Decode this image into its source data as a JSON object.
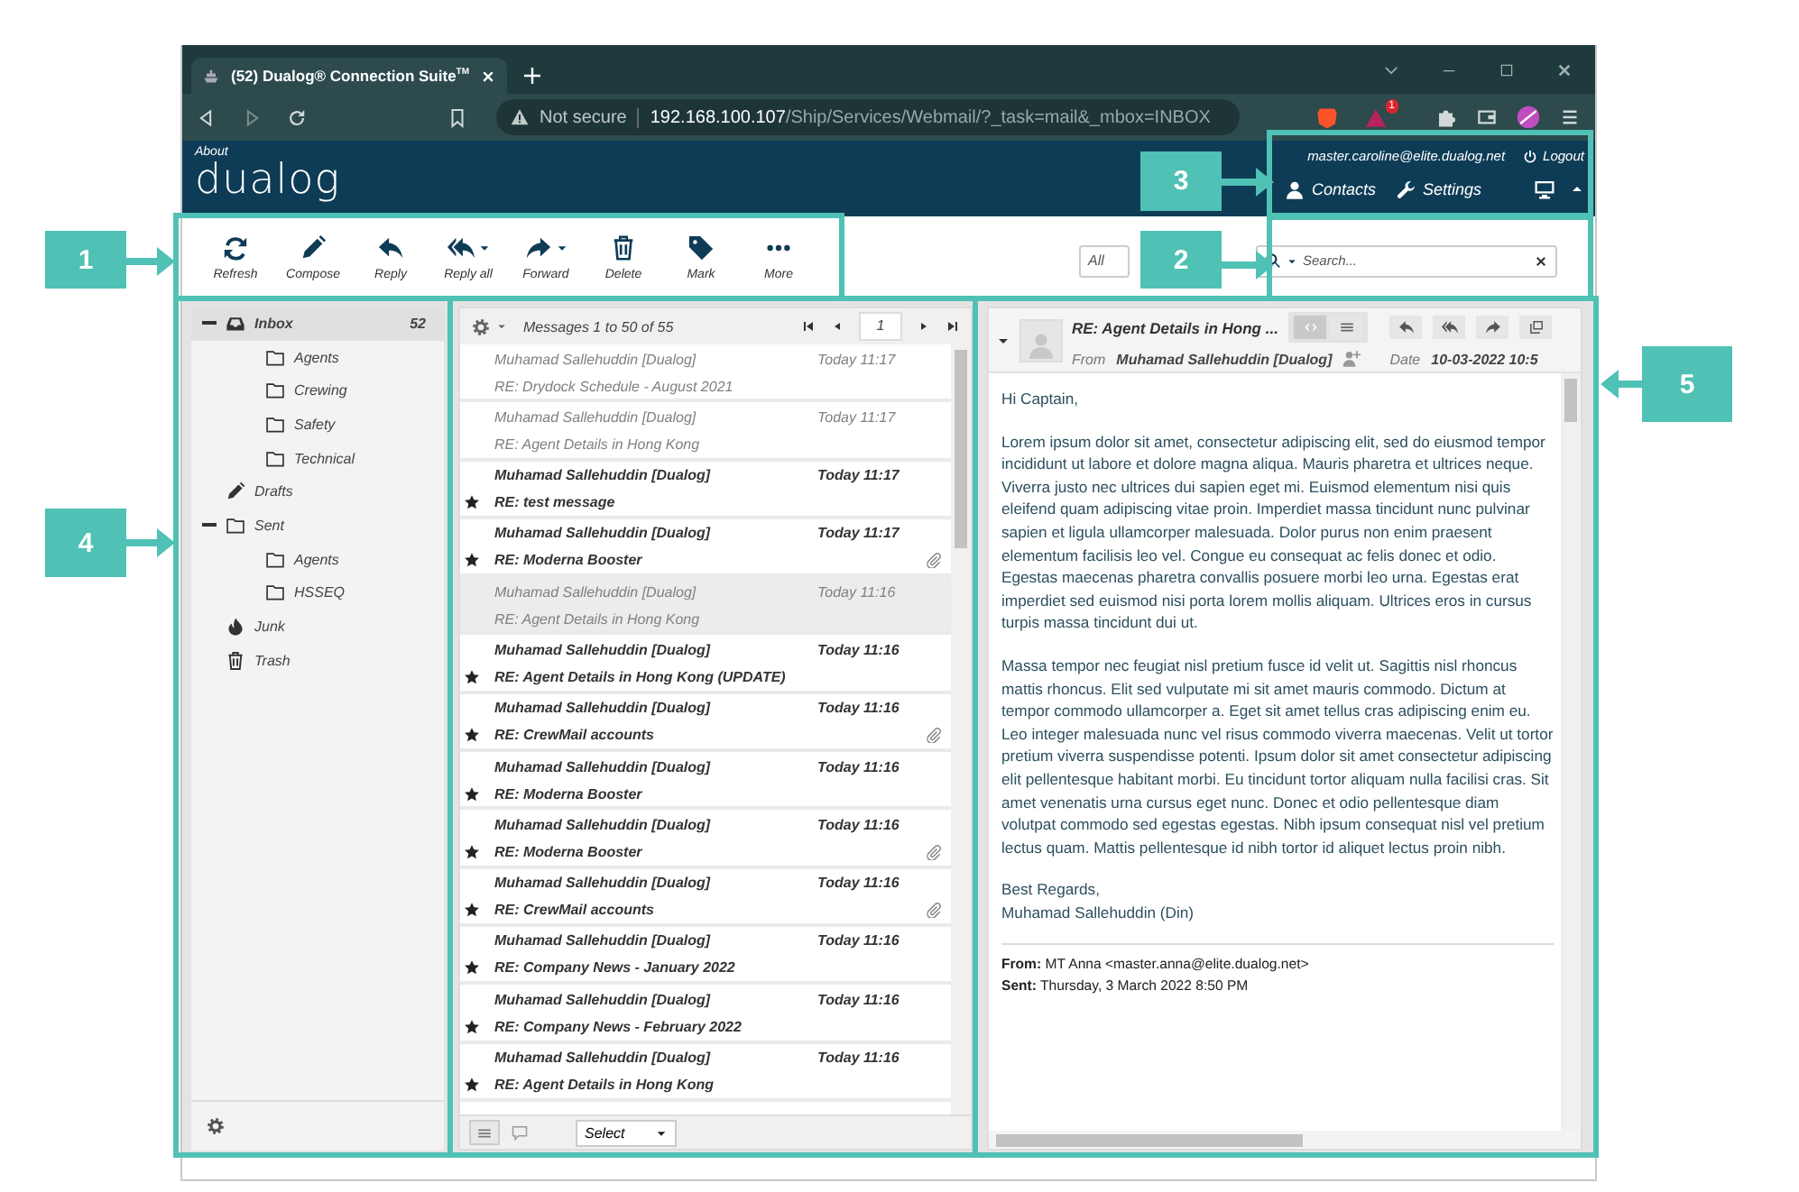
{
  "browser": {
    "tab_title": "(52) Dualog® Connection Suite$^{TM}$",
    "security": "Not secure",
    "url_host": "192.168.100.107",
    "url_path": "/Ship/Services/Webmail/?_task=mail&_mbox=INBOX",
    "alerts_badge": "1"
  },
  "header": {
    "about": "About",
    "logo": "dualog",
    "account": "master.caroline@elite.dualog.net",
    "logout": "Logout",
    "nav": [
      {
        "kind": "contacts",
        "label": "Contacts"
      },
      {
        "kind": "settings",
        "label": "Settings"
      }
    ]
  },
  "toolbar": {
    "buttons": [
      {
        "kind": "refresh",
        "label": "Refresh",
        "menu": false
      },
      {
        "kind": "compose",
        "label": "Compose",
        "menu": false
      },
      {
        "kind": "reply",
        "label": "Reply",
        "menu": false
      },
      {
        "kind": "reply_all",
        "label": "Reply all",
        "menu": true
      },
      {
        "kind": "forward",
        "label": "Forward",
        "menu": true
      },
      {
        "kind": "delete",
        "label": "Delete",
        "menu": false
      },
      {
        "kind": "mark",
        "label": "Mark",
        "menu": false
      },
      {
        "kind": "more",
        "label": "More",
        "menu": false
      }
    ],
    "filter": "All",
    "search_placeholder": "Search..."
  },
  "folders": [
    {
      "kind": "inbox",
      "name": "Inbox",
      "count": "52",
      "selected": true,
      "expanded": true,
      "children": [
        {
          "kind": "folder",
          "name": "Agents",
          "selected": false
        },
        {
          "kind": "folder",
          "name": "Crewing",
          "selected": false
        },
        {
          "kind": "folder",
          "name": "Safety",
          "selected": false
        },
        {
          "kind": "folder",
          "name": "Technical",
          "selected": false
        }
      ]
    },
    {
      "kind": "drafts",
      "name": "Drafts",
      "selected": false
    },
    {
      "kind": "folder",
      "name": "Sent",
      "selected": false,
      "expanded": true,
      "children": [
        {
          "kind": "folder",
          "name": "Agents",
          "selected": false
        },
        {
          "kind": "folder",
          "name": "HSSEQ",
          "selected": false
        }
      ]
    },
    {
      "kind": "junk",
      "name": "Junk",
      "selected": false
    },
    {
      "kind": "trash",
      "name": "Trash",
      "selected": false
    }
  ],
  "message_list": {
    "summary": "Messages 1 to 50 of 55",
    "page": "1",
    "select": "Select",
    "messages": [
      {
        "from": "Muhamad Sallehuddin [Dualog]",
        "date": "Today 11:17",
        "subject": "RE: Drydock Schedule - August 2021",
        "unread": false,
        "starred": false,
        "attachment": false,
        "selected": false
      },
      {
        "from": "Muhamad Sallehuddin [Dualog]",
        "date": "Today 11:17",
        "subject": "RE: Agent Details in Hong Kong",
        "unread": false,
        "starred": false,
        "attachment": false,
        "selected": false
      },
      {
        "from": "Muhamad Sallehuddin [Dualog]",
        "date": "Today 11:17",
        "subject": "RE: test message",
        "unread": true,
        "starred": true,
        "attachment": false,
        "selected": false
      },
      {
        "from": "Muhamad Sallehuddin [Dualog]",
        "date": "Today 11:17",
        "subject": "RE: Moderna Booster",
        "unread": true,
        "starred": true,
        "attachment": true,
        "selected": false
      },
      {
        "from": "Muhamad Sallehuddin [Dualog]",
        "date": "Today 11:16",
        "subject": "RE: Agent Details in Hong Kong",
        "unread": false,
        "starred": false,
        "attachment": false,
        "selected": true
      },
      {
        "from": "Muhamad Sallehuddin [Dualog]",
        "date": "Today 11:16",
        "subject": "RE: Agent Details in Hong Kong (UPDATE)",
        "unread": true,
        "starred": true,
        "attachment": false,
        "selected": false
      },
      {
        "from": "Muhamad Sallehuddin [Dualog]",
        "date": "Today 11:16",
        "subject": "RE: CrewMail accounts",
        "unread": true,
        "starred": true,
        "attachment": true,
        "selected": false
      },
      {
        "from": "Muhamad Sallehuddin [Dualog]",
        "date": "Today 11:16",
        "subject": "RE: Moderna Booster",
        "unread": true,
        "starred": true,
        "attachment": false,
        "selected": false
      },
      {
        "from": "Muhamad Sallehuddin [Dualog]",
        "date": "Today 11:16",
        "subject": "RE: Moderna Booster",
        "unread": true,
        "starred": true,
        "attachment": true,
        "selected": false
      },
      {
        "from": "Muhamad Sallehuddin [Dualog]",
        "date": "Today 11:16",
        "subject": "RE: CrewMail accounts",
        "unread": true,
        "starred": true,
        "attachment": true,
        "selected": false
      },
      {
        "from": "Muhamad Sallehuddin [Dualog]",
        "date": "Today 11:16",
        "subject": "RE: Company News - January 2022",
        "unread": true,
        "starred": true,
        "attachment": false,
        "selected": false
      },
      {
        "from": "Muhamad Sallehuddin [Dualog]",
        "date": "Today 11:16",
        "subject": "RE: Company News - February 2022",
        "unread": true,
        "starred": true,
        "attachment": false,
        "selected": false
      },
      {
        "from": "Muhamad Sallehuddin [Dualog]",
        "date": "Today 11:16",
        "subject": "RE: Agent Details in Hong Kong",
        "unread": true,
        "starred": true,
        "attachment": false,
        "selected": false
      }
    ]
  },
  "preview": {
    "subject": "RE: Agent Details in Hong ...",
    "from_label": "From",
    "from": "Muhamad Sallehuddin [Dualog]",
    "date_label": "Date",
    "date": "10-03-2022 10:5",
    "body": [
      "Hi Captain,",
      "Lorem ipsum dolor sit amet, consectetur adipiscing elit, sed do eiusmod tempor incididunt ut labore et dolore magna aliqua. Mauris pharetra et ultrices neque. Viverra justo nec ultrices dui sapien eget mi. Euismod elementum nisi quis eleifend quam adipiscing vitae proin. Imperdiet massa tincidunt nunc pulvinar sapien et ligula ullamcorper malesuada. Dolor purus non enim praesent elementum facilisis leo vel. Congue eu consequat ac felis donec et odio. Egestas maecenas pharetra convallis posuere morbi leo urna. Egestas erat imperdiet sed euismod nisi porta lorem mollis aliquam. Ultrices eros in cursus turpis massa tincidunt dui ut.",
      "Massa tempor nec feugiat nisl pretium fusce id velit ut. Sagittis nisl rhoncus mattis rhoncus. Elit sed vulputate mi sit amet mauris commodo. Dictum at tempor commodo ullamcorper a. Eget sit amet tellus cras adipiscing enim eu. Leo integer malesuada nunc vel risus commodo viverra maecenas. Velit ut tortor pretium viverra suspendisse potenti. Ipsum dolor sit amet consectetur adipiscing elit pellentesque habitant morbi. Eu tincidunt tortor aliquam nulla facilisi cras. Sit amet venenatis urna cursus eget nunc. Donec et odio pellentesque diam volutpat commodo sed egestas egestas. Nibh ipsum consequat nisl vel pretium lectus quam. Mattis pellentesque id nibh tortor id aliquet lectus proin nibh.",
      "Best Regards,\nMuhamad Sallehuddin (Din)"
    ],
    "quote": [
      {
        "label": "From:",
        "value": "MT Anna <master.anna@elite.dualog.net>"
      },
      {
        "label": "Sent:",
        "value": "Thursday, 3 March 2022 8:50 PM"
      }
    ]
  },
  "callouts": [
    {
      "number": "1"
    },
    {
      "number": "2"
    },
    {
      "number": "3"
    },
    {
      "number": "4"
    },
    {
      "number": "5"
    }
  ]
}
